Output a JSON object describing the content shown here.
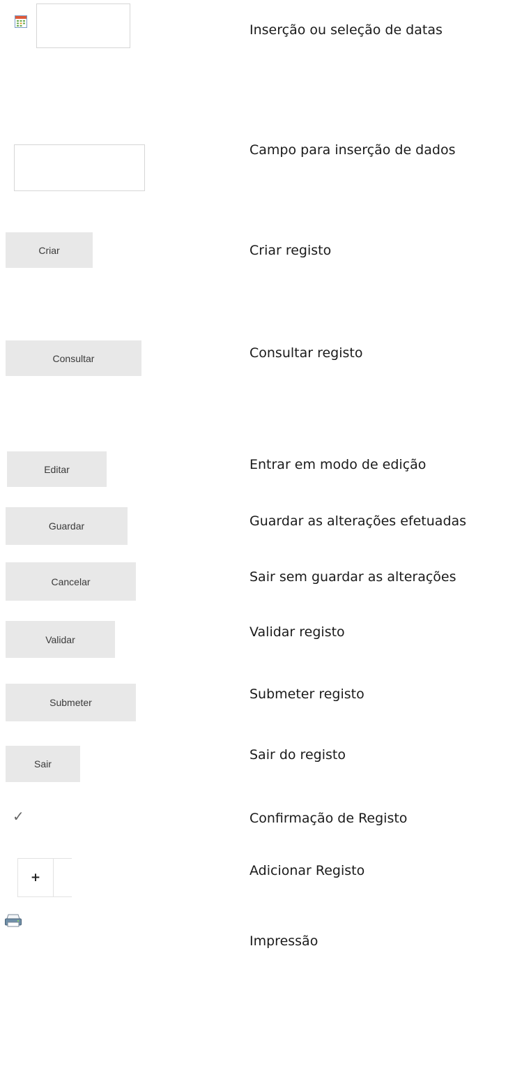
{
  "rows": {
    "date_picker": {
      "description": "Inserção ou seleção de datas",
      "icon": "calendar-icon",
      "value": ""
    },
    "input_field": {
      "description": "Campo para inserção de dados",
      "value": ""
    },
    "criar": {
      "label": "Criar",
      "description": "Criar registo"
    },
    "consultar": {
      "label": "Consultar",
      "description": "Consultar registo"
    },
    "editar": {
      "label": "Editar",
      "description": "Entrar em modo de edição"
    },
    "guardar": {
      "label": "Guardar",
      "description": "Guardar as alterações efetuadas"
    },
    "cancelar": {
      "label": "Cancelar",
      "description": "Sair sem guardar as alterações"
    },
    "validar": {
      "label": "Validar",
      "description": "Validar registo"
    },
    "submeter": {
      "label": "Submeter",
      "description": "Submeter registo"
    },
    "sair": {
      "label": "Sair",
      "description": "Sair do registo"
    },
    "confirmacao": {
      "icon": "checkmark-icon",
      "glyph": "✓",
      "description": "Confirmação de Registo"
    },
    "adicionar": {
      "icon": "plus-icon",
      "glyph": "+",
      "description": "Adicionar Registo"
    },
    "impressao": {
      "icon": "printer-icon",
      "description": "Impressão"
    }
  },
  "colors": {
    "button_bg": "#e8e8e8",
    "field_border": "#d6d6d6",
    "text": "#1a1a1a"
  }
}
